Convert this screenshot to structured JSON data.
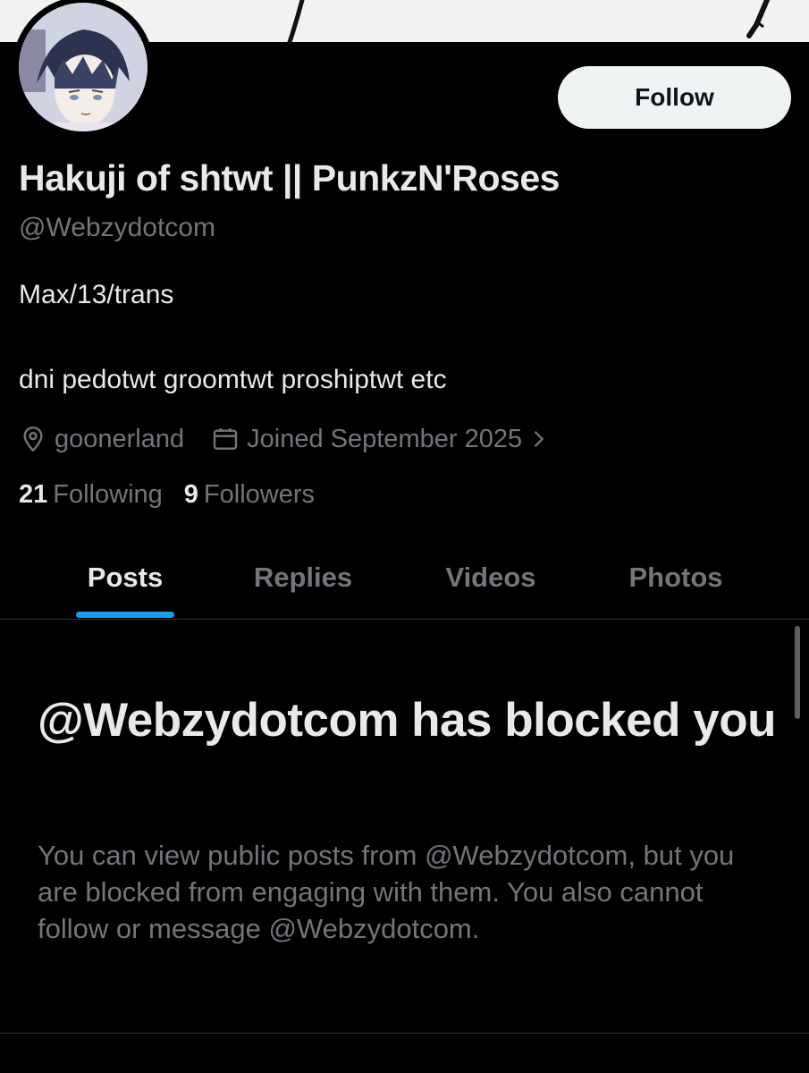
{
  "profile": {
    "display_name": "Hakuji of shtwt || PunkzN'Roses",
    "handle": "@Webzydotcom",
    "bio_lines": [
      "Max/13/trans",
      "dni pedotwt groomtwt proshiptwt etc"
    ],
    "location": "goonerland",
    "joined": "Joined September 2025",
    "following_count": "21",
    "following_label": "Following",
    "followers_count": "9",
    "followers_label": "Followers"
  },
  "actions": {
    "follow_label": "Follow"
  },
  "tabs": [
    {
      "label": "Posts",
      "active": true
    },
    {
      "label": "Replies",
      "active": false
    },
    {
      "label": "Videos",
      "active": false
    },
    {
      "label": "Photos",
      "active": false
    }
  ],
  "blocked": {
    "title": "@Webzydotcom has blocked you",
    "description": "You can view public posts from @Webzydotcom, but you are blocked from engaging with them. You also cannot follow or message @Webzydotcom."
  },
  "icons": {
    "location": "location-pin-icon",
    "calendar": "calendar-icon",
    "chevron": "chevron-right-icon"
  },
  "colors": {
    "background": "#000000",
    "primary_text": "#e7e9ea",
    "secondary_text": "#71767b",
    "accent": "#1d9bf0",
    "follow_button_bg": "#eff3f4"
  }
}
